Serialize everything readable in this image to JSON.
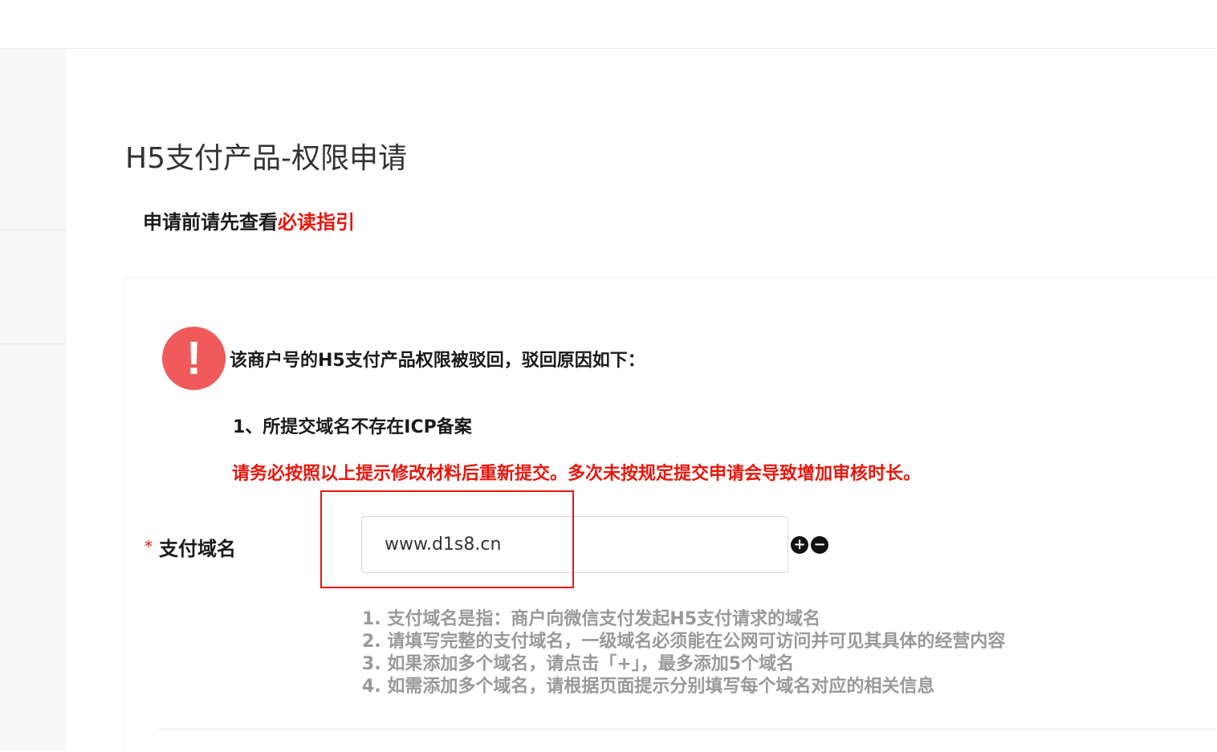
{
  "page": {
    "title": "H5支付产品-权限申请",
    "guide_prefix": "申请前请先查看",
    "guide_link": "必读指引"
  },
  "rejection": {
    "icon": "exclamation-icon",
    "title": "该商户号的H5支付产品权限被驳回，驳回原因如下：",
    "reasons": [
      "1、所提交域名不存在ICP备案"
    ],
    "warning": "请务必按照以上提示修改材料后重新提交。多次未按规定提交申请会导致增加审核时长。"
  },
  "form": {
    "required_mark": "*",
    "domain_label": "支付域名",
    "domain_value": "www.d1s8.cn",
    "add_symbol": "+",
    "remove_symbol": "−",
    "tips": [
      "1. 支付域名是指：商户向微信支付发起H5支付请求的域名",
      "2. 请填写完整的支付域名，一级域名必须能在公网可访问并可见其具体的经营内容",
      "3. 如果添加多个域名，请点击「+」，最多添加5个域名",
      "4. 如需添加多个域名，请根据页面提示分别填写每个域名对应的相关信息"
    ]
  },
  "colors": {
    "accent_red": "#e8170d",
    "warn_icon_bg": "#f05a5a",
    "tip_gray": "#999999"
  }
}
